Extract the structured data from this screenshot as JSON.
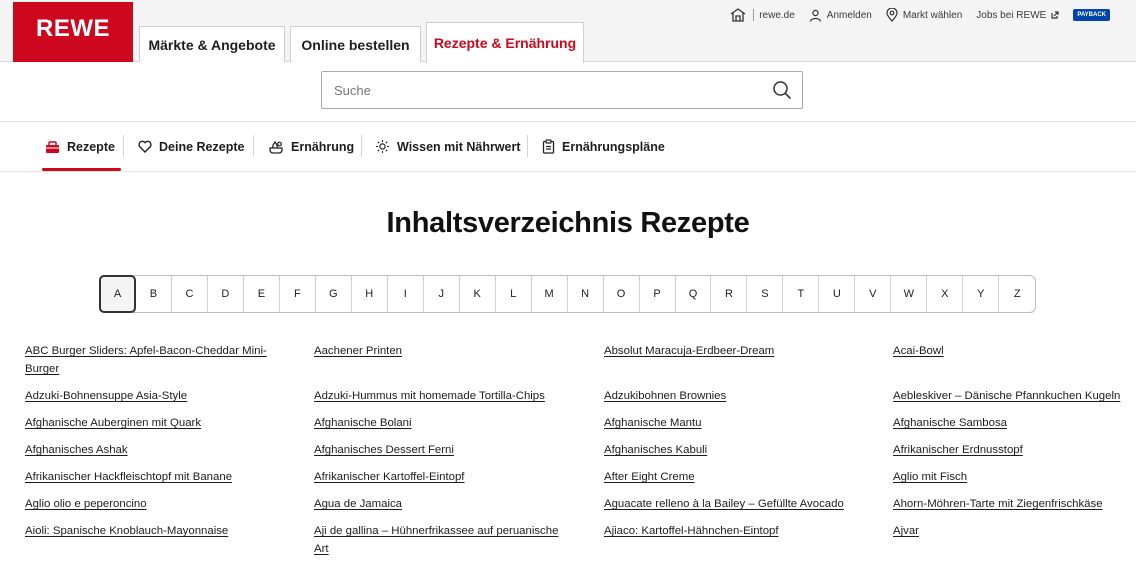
{
  "header": {
    "logo": "REWE",
    "tabs": [
      "Märkte & Angebote",
      "Online bestellen",
      "Rezepte & Ernährung"
    ],
    "service": {
      "home": "rewe.de",
      "login": "Anmelden",
      "market": "Markt wählen",
      "jobs": "Jobs bei REWE",
      "payback": "PAYBACK"
    }
  },
  "search": {
    "placeholder": "Suche"
  },
  "categories": [
    "Rezepte",
    "Deine Rezepte",
    "Ernährung",
    "Wissen mit Nährwert",
    "Ernährungspläne"
  ],
  "page_title": "Inhaltsverzeichnis Rezepte",
  "alphabet": [
    "A",
    "B",
    "C",
    "D",
    "E",
    "F",
    "G",
    "H",
    "I",
    "J",
    "K",
    "L",
    "M",
    "N",
    "O",
    "P",
    "Q",
    "R",
    "S",
    "T",
    "U",
    "V",
    "W",
    "X",
    "Y",
    "Z"
  ],
  "selected_letter": "A",
  "recipes": {
    "col1": [
      "ABC Burger Sliders: Apfel-Bacon-Cheddar Mini-",
      "Burger",
      "Adzuki-Bohnensuppe Asia-Style",
      "Afghanische Auberginen mit Quark",
      "Afghanisches Ashak",
      "Afrikanischer Hackfleischtopf mit Banane",
      "Aglio olio e peperoncino",
      "Aioli: Spanische Knoblauch-Mayonnaise"
    ],
    "col2": [
      "Aachener Printen",
      "Adzuki-Hummus mit homemade Tortilla-Chips",
      "Afghanische Bolani",
      "Afghanisches Dessert Ferni",
      "Afrikanischer Kartoffel-Eintopf",
      "Agua de Jamaica",
      "Aji de gallina – Hühnerfrikassee auf peruanische",
      "Art"
    ],
    "col3": [
      "Absolut Maracuja-Erdbeer-Dream",
      "Adzukibohnen Brownies",
      "Afghanische Mantu",
      "Afghanisches Kabuli",
      "After Eight Creme",
      "Aguacate relleno à la Bailey – Gefüllte Avocado",
      "Ajiaco: Kartoffel-Hähnchen-Eintopf"
    ],
    "col4": [
      "Acai-Bowl",
      "Aebleskiver – Dänische Pfannkuchen Kugeln",
      "Afghanische Sambosa",
      "Afrikanischer Erdnusstopf",
      "Aglio mit Fisch",
      "Ahorn-Möhren-Tarte mit Ziegenfrischkäse",
      "Ajvar"
    ]
  }
}
